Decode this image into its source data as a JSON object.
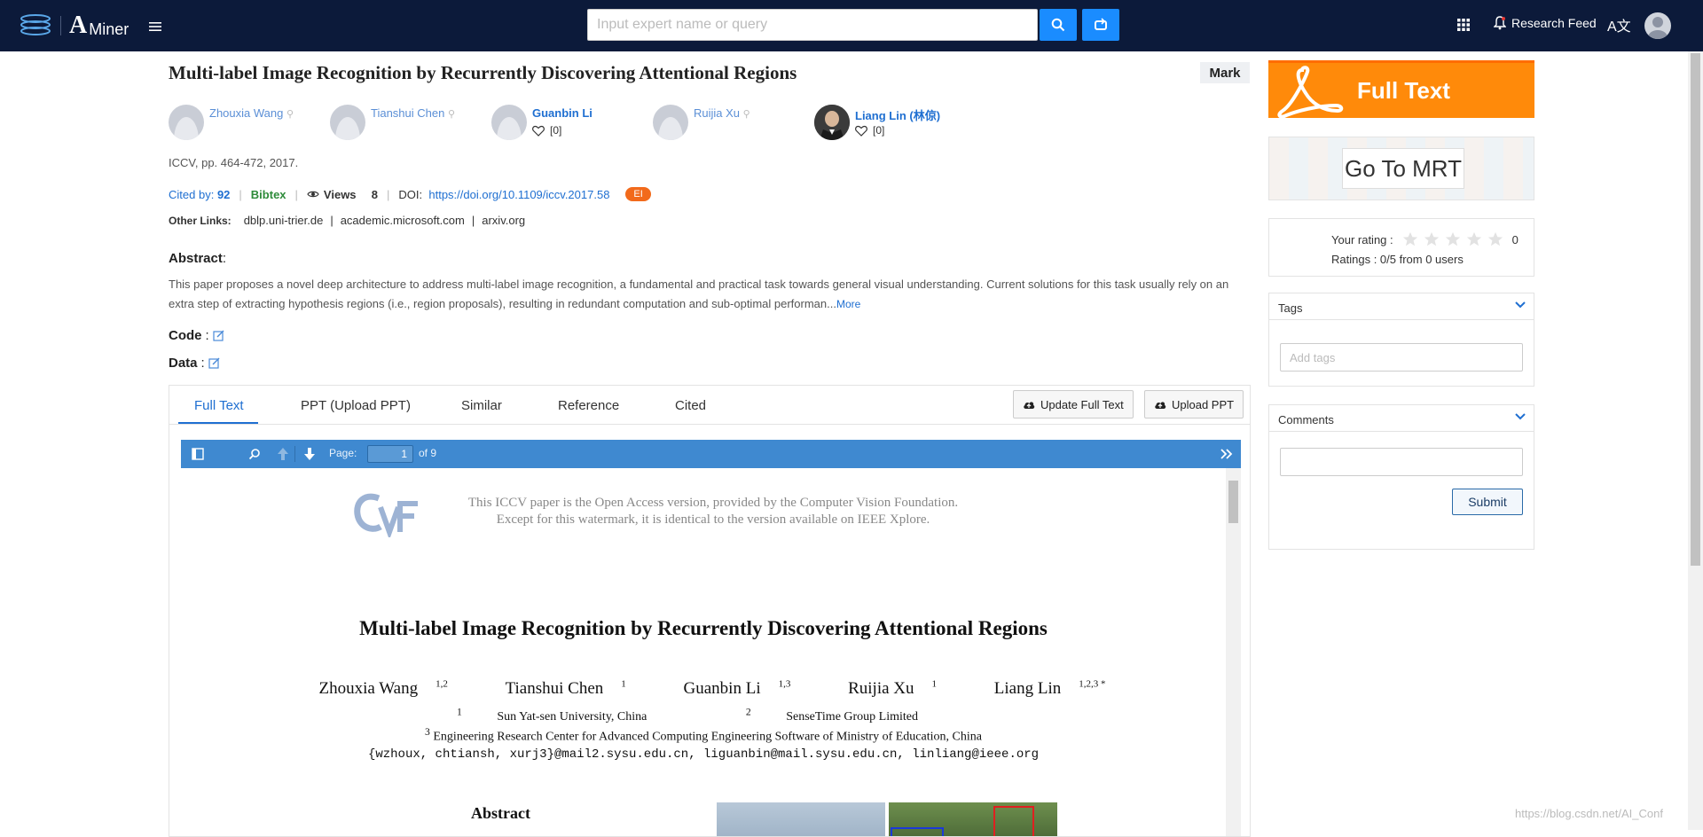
{
  "topbar": {
    "brand_a": "A",
    "brand_text": "Miner",
    "search_placeholder": "Input expert name or query",
    "research_feed": "Research Feed",
    "lang_glyph": "A文"
  },
  "paper": {
    "title": "Multi-label Image Recognition by Recurrently Discovering Attentional Regions",
    "mark_label": "Mark",
    "authors": [
      {
        "name": "Zhouxia Wang",
        "bold": false
      },
      {
        "name": "Tianshui Chen",
        "bold": false
      },
      {
        "name": "Guanbin Li",
        "bold": true,
        "likes": "[0]"
      },
      {
        "name": "Ruijia Xu",
        "bold": false
      },
      {
        "name": "Liang Lin (林倞)",
        "bold": true,
        "likes": "[0]"
      }
    ],
    "venue": "ICCV, pp. 464-472, 2017.",
    "cited_by_label": "Cited by:",
    "cited_by_count": "92",
    "bibtex": "Bibtex",
    "views_label": "Views",
    "views_count": "8",
    "doi_label": "DOI:",
    "doi_link": "https://doi.org/10.1109/iccv.2017.58",
    "badge": "EI",
    "other_links_label": "Other Links:",
    "other_links": [
      "dblp.uni-trier.de",
      "academic.microsoft.com",
      "arxiv.org"
    ],
    "abstract_heading": "Abstract",
    "abstract_text": "This paper proposes a novel deep architecture to address multi-label image recognition, a fundamental and practical task towards general visual understanding. Current solutions for this task usually rely on an extra step of extracting hypothesis regions (i.e., region proposals), resulting in redundant computation and sub-optimal performan...",
    "abstract_more": "More",
    "code_heading": "Code",
    "data_heading": "Data"
  },
  "tabs": {
    "items": [
      "Full Text",
      "PPT (Upload PPT)",
      "Similar",
      "Reference",
      "Cited"
    ],
    "update_full_text": "Update Full Text",
    "upload_ppt": "Upload PPT"
  },
  "pdf": {
    "page_label": "Page:",
    "page_current": "1",
    "page_total": "of 9",
    "watermark_line1": "This ICCV paper is the Open Access version, provided by the Computer Vision Foundation.",
    "watermark_line2": "Except for this watermark, it is identical to the version available on IEEE Xplore.",
    "title": "Multi-label Image Recognition by Recurrently Discovering Attentional Regions",
    "authors": [
      {
        "name": "Zhouxia Wang",
        "sup": "1,2"
      },
      {
        "name": "Tianshui Chen",
        "sup": "1"
      },
      {
        "name": "Guanbin Li",
        "sup": "1,3"
      },
      {
        "name": "Ruijia Xu",
        "sup": "1"
      },
      {
        "name": "Liang Lin",
        "sup": "1,2,3 *"
      }
    ],
    "aff1_sup": "1",
    "aff1": "Sun Yat-sen University, China",
    "aff2_sup": "2",
    "aff2": "SenseTime Group Limited",
    "aff3_sup": "3",
    "aff3": "Engineering Research Center for Advanced Computing Engineering Software of Ministry of Education, China",
    "emails": "{wzhoux, chtiansh, xurj3}@mail2.sysu.edu.cn, liguanbin@mail.sysu.edu.cn, linliang@ieee.org",
    "abstract_heading": "Abstract"
  },
  "sidebar": {
    "full_text": "Full Text",
    "go_to_mrt": "Go To MRT",
    "your_rating": "Your rating :",
    "rating_score": "0",
    "ratings_text": "Ratings : 0/5 from 0 users",
    "tags_heading": "Tags",
    "tags_placeholder": "Add tags",
    "comments_heading": "Comments",
    "submit": "Submit"
  },
  "watermark": "https://blog.csdn.net/AI_Conf",
  "colors": {
    "topbar": "#0c1a3a",
    "accent": "#1a8cff",
    "fulltext": "#ff8a0a",
    "badge": "#f26a1b",
    "pdfbar": "#3f89d0"
  }
}
